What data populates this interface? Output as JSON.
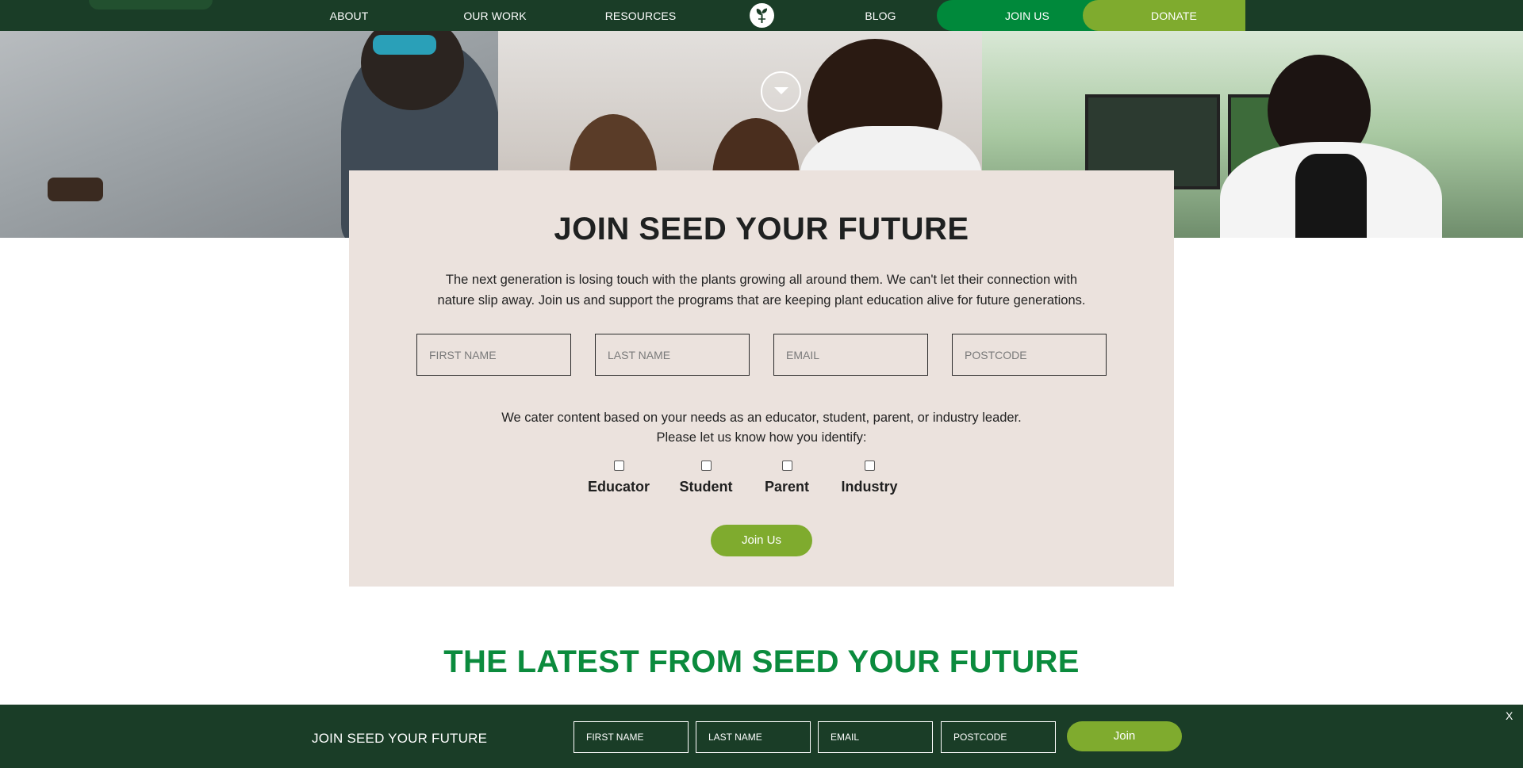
{
  "nav": {
    "items": [
      "ABOUT",
      "OUR WORK",
      "RESOURCES",
      "BLOG"
    ],
    "join_label": "JOIN US",
    "donate_label": "DONATE",
    "logo_icon": "seedling-icon"
  },
  "hero": {
    "scroll_icon": "chevron-down-icon"
  },
  "join_form": {
    "title": "JOIN SEED YOUR FUTURE",
    "description": "The next generation is losing touch with the plants growing all around them. We can't let their connection with nature slip away. Join us and support the programs that are keeping plant education alive for future generations.",
    "fields": {
      "first_name": "FIRST NAME",
      "last_name": "LAST NAME",
      "email": "EMAIL",
      "postcode": "POSTCODE"
    },
    "identify_line1": "We cater content based on your needs as an educator, student, parent, or industry leader.",
    "identify_line2": "Please let us know how you identify:",
    "options": [
      "Educator",
      "Student",
      "Parent",
      "Industry"
    ],
    "submit_label": "Join Us"
  },
  "latest": {
    "heading": "THE LATEST FROM SEED YOUR FUTURE"
  },
  "sticky_bar": {
    "title": "JOIN SEED YOUR FUTURE",
    "fields": {
      "first_name": "FIRST NAME",
      "last_name": "LAST NAME",
      "email": "EMAIL",
      "postcode": "POSTCODE"
    },
    "submit_label": "Join",
    "close_label": "X"
  },
  "colors": {
    "nav_bg": "#1a3d27",
    "join_green": "#00893b",
    "donate_green": "#7fab2e",
    "card_bg": "#ebe2dd",
    "heading_green": "#0b8b3d"
  }
}
